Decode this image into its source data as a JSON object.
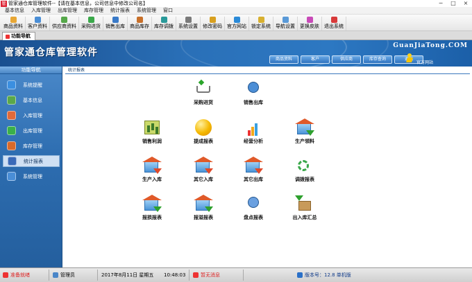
{
  "window": {
    "title": "管家通仓库管理软件--【请在基本信息，公司信息中修改公司名】",
    "app_icon": "管",
    "controls": [
      "−",
      "□",
      "×"
    ]
  },
  "menubar": [
    "基本信息",
    "入库管理",
    "出库管理",
    "库存管理",
    "统计报表",
    "系统管理",
    "窗口"
  ],
  "toolbar": [
    "商品资料",
    "客户资料",
    "供应商资料",
    "采购进货",
    "销售出库",
    "商品库存",
    "库存调拨",
    "系统设置",
    "修改密码",
    "官方网站",
    "锁定系统",
    "导航设置",
    "更换皮肤",
    "退出系统"
  ],
  "tab": {
    "label": "功能导航"
  },
  "banner": {
    "title": "管家通仓库管理软件",
    "site": "GuanJiaTong.COM",
    "nav_buttons": [
      "商品资料",
      "客户",
      "供应商",
      "库存查询",
      "退出"
    ],
    "official_label": "官方网站"
  },
  "sidebar": {
    "header": "功能导航",
    "items": [
      "系统提醒",
      "基本信息",
      "入库管理",
      "出库管理",
      "库存管理",
      "统计报表",
      "系统管理"
    ],
    "active": "统计报表"
  },
  "main": {
    "breadcrumb": "统计报表",
    "items": [
      "采购进货",
      "销售出库",
      "销售利润",
      "提成报表",
      "经营分析",
      "生产领料",
      "生产入库",
      "其它入库",
      "其它出库",
      "调拨报表",
      "报损报表",
      "报溢报表",
      "盘点报表",
      "出入库汇总"
    ]
  },
  "statusbar": {
    "connection": "准备就绪",
    "user": "管理员",
    "date": "2017年8月11日 星期五",
    "time": "10:48:03",
    "message": "暂无消息",
    "version": "版本号：12.8 单机版"
  },
  "colors": {
    "banner": "#2a70b8",
    "sidebar": "#2d6db0",
    "accent_red": "#e53030"
  }
}
